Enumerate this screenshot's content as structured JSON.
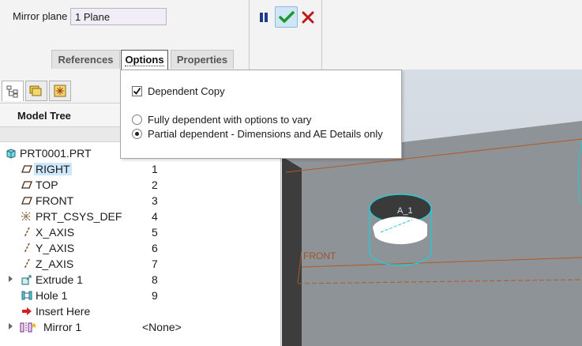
{
  "dashboard": {
    "mirror_plane_label": "Mirror plane",
    "mirror_plane_value": "1 Plane",
    "tabs": [
      "References",
      "Options",
      "Properties"
    ],
    "active_tab": "Options"
  },
  "options": {
    "dependent_copy_label": "Dependent Copy",
    "dependent_copy_checked": true,
    "radio_fully": "Fully dependent with options to vary",
    "radio_partial": "Partial dependent - Dimensions and AE Details only",
    "selected_radio": "partial"
  },
  "navigator": {
    "title": "Model Tree",
    "items": [
      {
        "label": "PRT0001.PRT",
        "num": "",
        "icon": "part-icon"
      },
      {
        "label": "RIGHT",
        "num": "1",
        "icon": "datum-plane-icon"
      },
      {
        "label": "TOP",
        "num": "2",
        "icon": "datum-plane-icon"
      },
      {
        "label": "FRONT",
        "num": "3",
        "icon": "datum-plane-icon"
      },
      {
        "label": "PRT_CSYS_DEF",
        "num": "4",
        "icon": "csys-icon"
      },
      {
        "label": "X_AXIS",
        "num": "5",
        "icon": "datum-axis-icon"
      },
      {
        "label": "Y_AXIS",
        "num": "6",
        "icon": "datum-axis-icon"
      },
      {
        "label": "Z_AXIS",
        "num": "7",
        "icon": "datum-axis-icon"
      },
      {
        "label": "Extrude 1",
        "num": "8",
        "icon": "extrude-icon"
      },
      {
        "label": "Hole 1",
        "num": "9",
        "icon": "hole-icon"
      },
      {
        "label": "Insert Here",
        "num": "",
        "icon": "insert-arrow-icon"
      },
      {
        "label": "Mirror 1",
        "num": "<None>",
        "icon": "mirror-icon"
      }
    ]
  },
  "viewport": {
    "hole_label": "A_1",
    "plane_label": "FRONT"
  },
  "colors": {
    "accent_check": "#1a9a2a",
    "cancel": "#c0171b",
    "datum": "#a0522d",
    "highlight": "#27c9d6",
    "selection": "#cde8fb"
  }
}
